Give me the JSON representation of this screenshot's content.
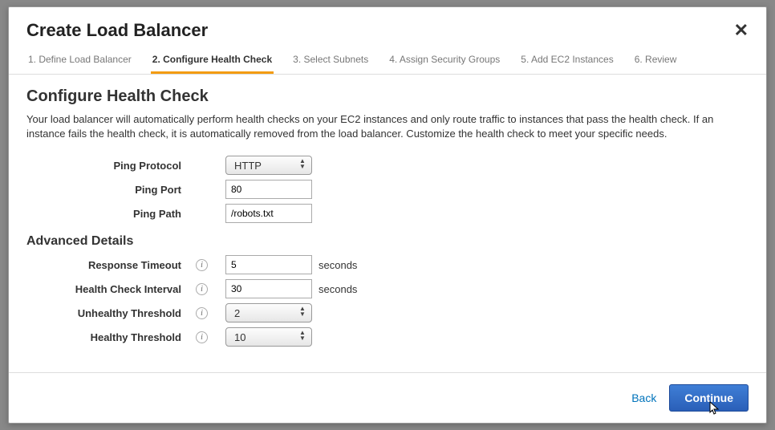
{
  "header": {
    "title": "Create Load Balancer"
  },
  "steps": [
    {
      "label": "1. Define Load Balancer"
    },
    {
      "label": "2. Configure Health Check"
    },
    {
      "label": "3. Select Subnets"
    },
    {
      "label": "4. Assign Security Groups"
    },
    {
      "label": "5. Add EC2 Instances"
    },
    {
      "label": "6. Review"
    }
  ],
  "section": {
    "title": "Configure Health Check",
    "description": "Your load balancer will automatically perform health checks on your EC2 instances and only route traffic to instances that pass the health check. If an instance fails the health check, it is automatically removed from the load balancer. Customize the health check to meet your specific needs."
  },
  "fields": {
    "ping_protocol": {
      "label": "Ping Protocol",
      "value": "HTTP"
    },
    "ping_port": {
      "label": "Ping Port",
      "value": "80"
    },
    "ping_path": {
      "label": "Ping Path",
      "value": "/robots.txt"
    }
  },
  "advanced": {
    "title": "Advanced Details",
    "response_timeout": {
      "label": "Response Timeout",
      "value": "5",
      "unit": "seconds"
    },
    "health_check_interval": {
      "label": "Health Check Interval",
      "value": "30",
      "unit": "seconds"
    },
    "unhealthy_threshold": {
      "label": "Unhealthy Threshold",
      "value": "2"
    },
    "healthy_threshold": {
      "label": "Healthy Threshold",
      "value": "10"
    }
  },
  "footer": {
    "back": "Back",
    "continue": "Continue"
  },
  "icons": {
    "info": "i"
  }
}
